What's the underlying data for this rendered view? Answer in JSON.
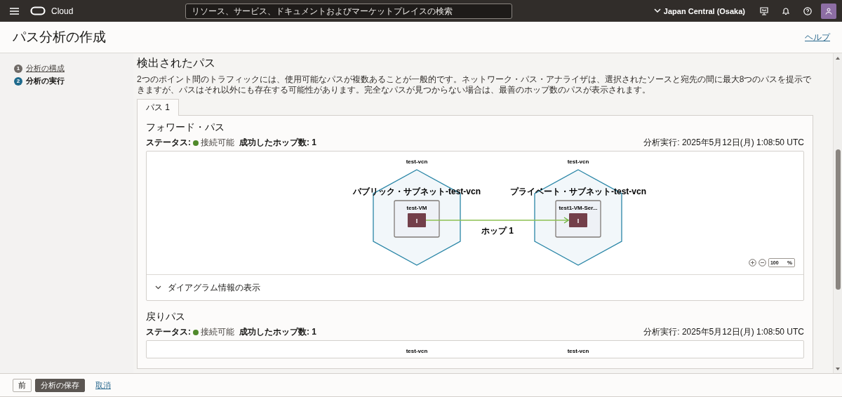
{
  "topbar": {
    "brand": "Cloud",
    "search": {
      "placeholder": "リソース、サービス、ドキュメントおよびマーケットプレイスの検索"
    },
    "region": "Japan Central (Osaka)"
  },
  "page": {
    "title": "パス分析の作成",
    "help_link": "ヘルプ"
  },
  "steps": [
    {
      "number": "1",
      "label": "分析の構成",
      "selected": false
    },
    {
      "number": "2",
      "label": "分析の実行",
      "selected": true
    }
  ],
  "content": {
    "heading": "検出されたパス",
    "description": "2つのポイント間のトラフィックには、使用可能なパスが複数あることが一般的です。ネットワーク・パス・アナライザは、選択されたソースと宛先の間に最大8つのパスを提示できますが、パスはそれ以外にも存在する可能性があります。完全なパスが見つからない場合は、最善のホップ数のパスが表示されます。",
    "tabs": [
      {
        "label": "パス 1",
        "selected": true
      }
    ],
    "paths": [
      {
        "title": "フォワード・パス",
        "status_label": "ステータス:",
        "status": "接続可能",
        "hops": "成功したホップ数: 1",
        "run_time": "分析実行: 2025年5月12日(月) 1:08:50 UTC",
        "diagram": {
          "nodes": [
            {
              "vcn": "test-vcn",
              "subnet": "パブリック・サブネット-test-vcn",
              "instance": "test-VM",
              "glyph": "I"
            },
            {
              "vcn": "test-vcn",
              "subnet": "プライベート・サブネット-test-vcn",
              "instance": "test1-VM-Ser...",
              "glyph": "I"
            }
          ],
          "hop_label": "ホップ 1",
          "zoom": "100",
          "zoom_unit": "%"
        },
        "details_toggle": {
          "label": "ダイアグラム情報の表示",
          "expanded": false
        }
      },
      {
        "title": "戻りパス",
        "status_label": "ステータス:",
        "status": "接続可能",
        "hops": "成功したホップ数: 1",
        "run_time": "分析実行: 2025年5月12日(月) 1:08:50 UTC",
        "diagram": {
          "nodes": [
            {
              "vcn": "test-vcn"
            },
            {
              "vcn": "test-vcn"
            }
          ]
        }
      }
    ]
  },
  "footer": {
    "buttons": [
      {
        "label": "前",
        "kind": "secondary"
      },
      {
        "label": "分析の保存",
        "kind": "primary"
      },
      {
        "label": "取消",
        "kind": "link"
      }
    ]
  }
}
